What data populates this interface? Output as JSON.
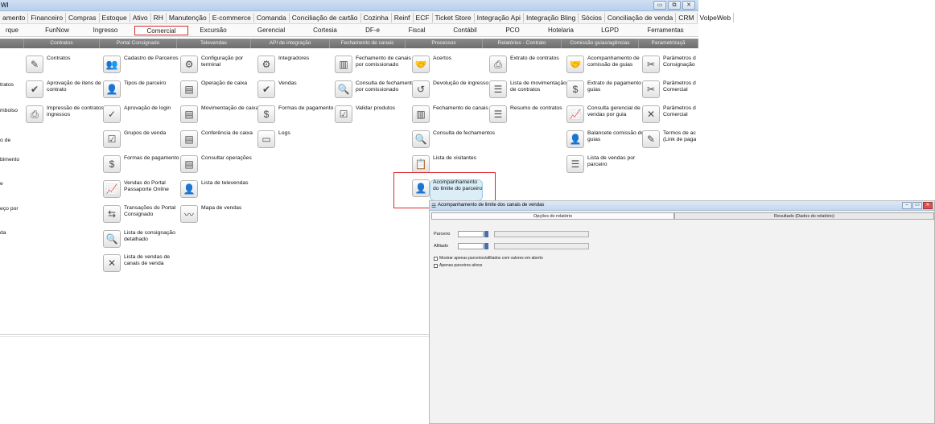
{
  "window": {
    "title": "WI",
    "buttons": [
      "▭",
      "⧉",
      "✕"
    ]
  },
  "menu": [
    "amento",
    "Financeiro",
    "Compras",
    "Estoque",
    "Ativo",
    "RH",
    "Manutenção",
    "E-commerce",
    "Comanda",
    "Conciliação de cartão",
    "Cozinha",
    "Reinf",
    "ECF",
    "Ticket Store",
    "Integração Api",
    "Integração Bling",
    "Sócios",
    "Conciliação de venda",
    "CRM",
    "VolpeWeb"
  ],
  "tabs": [
    "rque",
    "FunNow",
    "Ingresso",
    "Comercial",
    "Excursão",
    "Gerencial",
    "Cortesia",
    "DF-e",
    "Fiscal",
    "Contábil",
    "PCO",
    "Hotelaria",
    "LGPD",
    "Ferramentas"
  ],
  "categories": [
    "",
    "Contratos",
    "Portal Consignado",
    "Televendas",
    "API de integração",
    "Fechamento de canais",
    "Processos",
    "Relatórios - Contrato",
    "Comissão guias/agências",
    "Parametrizaçã"
  ],
  "left_partial": [
    "tratos",
    "mbolso",
    "o de",
    "bimento",
    "e",
    "eço por",
    "da"
  ],
  "items": {
    "contratos": [
      "Contratos",
      "Aprovação de itens de contrato",
      "Impressão de contratos e ingressos"
    ],
    "portal": [
      "Cadastro de Parceiros",
      "Tipos de parceiro",
      "Aprovação de login",
      "Grupos de venda",
      "Formas de pagamento",
      "Vendas do Portal Passaporte Online",
      "Transações do Portal Consignado",
      "Lista de consignação detalhado",
      "Lista de vendas de canais de venda"
    ],
    "televendas": [
      "Configuração por terminal",
      "Operação de caixa",
      "Movimentação de caixa",
      "Conferência de caixa",
      "Consultar operações",
      "Lista de televendas",
      "Mapa de vendas"
    ],
    "api": [
      "Integradores",
      "Vendas",
      "Formas de pagamento",
      "Logs"
    ],
    "fechamento": [
      "Fechamento de canais por comissionado",
      "Consulta de fechamentos por comissionado",
      "Validar produtos"
    ],
    "processos": [
      "Acertos",
      "Devolução de ingresso",
      "Fechamento de canais",
      "Consulta de fechamentos",
      "Lista de visitantes",
      "Acompanhamento do limite do parceiro"
    ],
    "relatorios": [
      "Extrato de contratos",
      "Lista de movimentação de contratos",
      "Resumo de contratos"
    ],
    "comissao": [
      "Acompanhamento de comissão de guias",
      "Extrato de pagamento de guias",
      "Consulta gerencial de vendas por guia",
      "Balancete comissão dos guias",
      "Lista de vendas por parceiro"
    ],
    "param": [
      "Parâmetros d Consignação",
      "Parâmetros d Comercial",
      "Parâmetros d Comercial",
      "Termos de ac (Link de paga"
    ]
  },
  "report": {
    "title": "Acompanhamento de limite dos canais de vendas",
    "tab_options": "Opções do relatório",
    "tab_result": "Resultado (Dados do relatório)",
    "field_parceiro": "Parceiro",
    "field_afiliado": "Afiliado",
    "chk_aberto": "Mostrar apenas parceiros/afiliados com valores em aberto",
    "chk_ativos": "Apenas parceiros ativos"
  }
}
